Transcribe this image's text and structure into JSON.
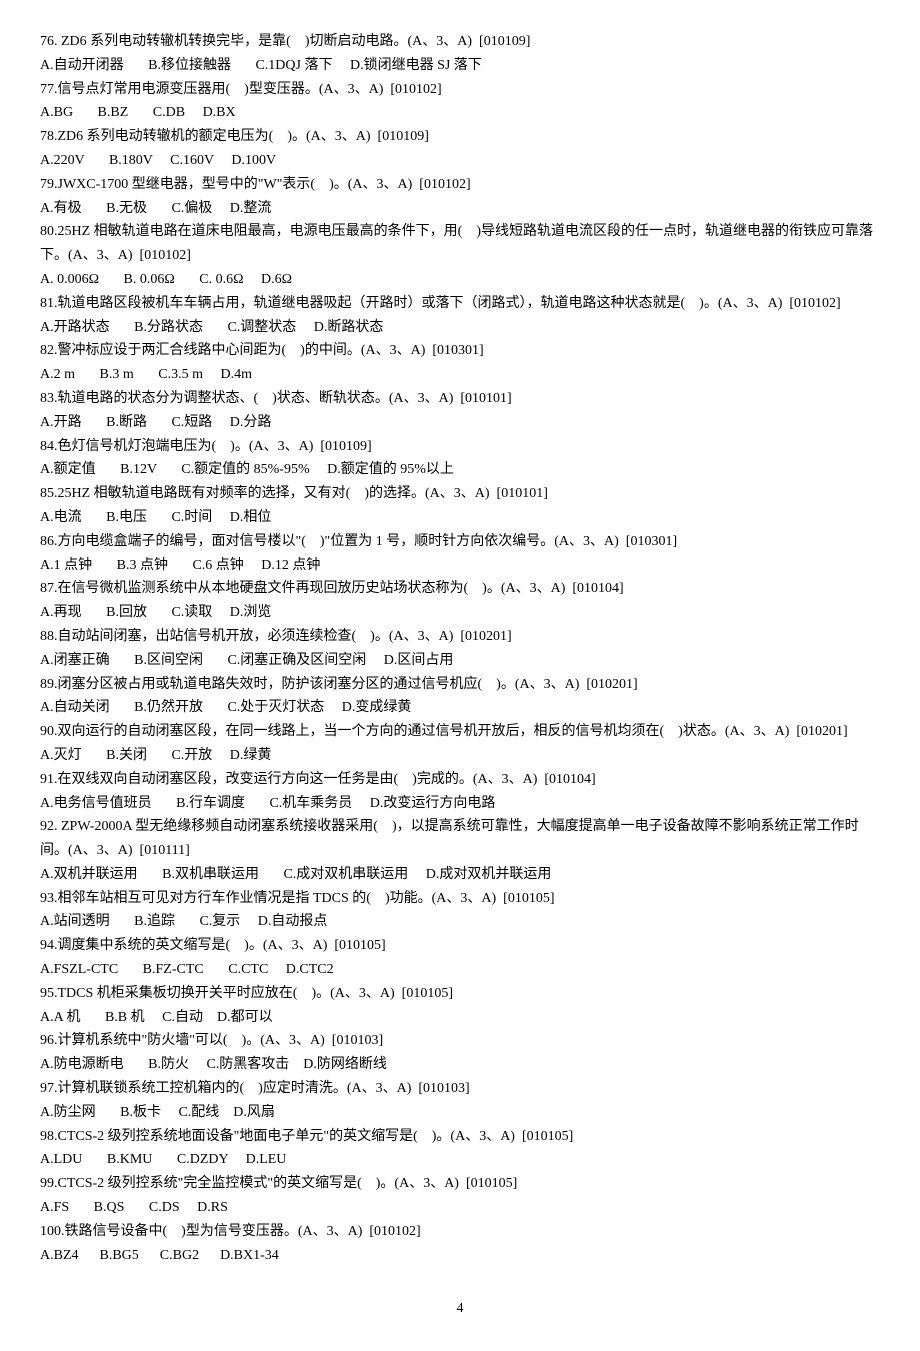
{
  "questions": [
    {
      "q": "76. ZD6 系列电动转辙机转换完毕，是靠(    )切断启动电路。(A、3、A)  [010109]",
      "opts": "A.自动开闭器       B.移位接触器       C.1DQJ 落下     D.锁闭继电器 SJ 落下"
    },
    {
      "q": "77.信号点灯常用电源变压器用(    )型变压器。(A、3、A)  [010102]",
      "opts": "A.BG       B.BZ       C.DB     D.BX"
    },
    {
      "q": "78.ZD6 系列电动转辙机的额定电压为(    )。(A、3、A)  [010109]",
      "opts": "A.220V       B.180V     C.160V     D.100V"
    },
    {
      "q": "79.JWXC-1700 型继电器，型号中的\"W\"表示(    )。(A、3、A)  [010102]",
      "opts": "A.有极       B.无极       C.偏极     D.整流"
    },
    {
      "q": "80.25HZ 相敏轨道电路在道床电阻最高，电源电压最高的条件下，用(    )导线短路轨道电流区段的任一点时，轨道继电器的衔铁应可靠落下。(A、3、A)  [010102]",
      "opts": "A. 0.006Ω       B. 0.06Ω       C. 0.6Ω     D.6Ω"
    },
    {
      "q": "81.轨道电路区段被机车车辆占用，轨道继电器吸起（开路时）或落下（闭路式），轨道电路这种状态就是(    )。(A、3、A)  [010102]",
      "opts": "A.开路状态       B.分路状态       C.调整状态     D.断路状态"
    },
    {
      "q": "82.警冲标应设于两汇合线路中心间距为(    )的中间。(A、3、A)  [010301]",
      "opts": "A.2 m       B.3 m       C.3.5 m     D.4m"
    },
    {
      "q": "83.轨道电路的状态分为调整状态、(    )状态、断轨状态。(A、3、A)  [010101]",
      "opts": "A.开路       B.断路       C.短路     D.分路"
    },
    {
      "q": "84.色灯信号机灯泡端电压为(    )。(A、3、A)  [010109]",
      "opts": "A.额定值       B.12V       C.额定值的 85%-95%     D.额定值的 95%以上"
    },
    {
      "q": "85.25HZ 相敏轨道电路既有对频率的选择，又有对(    )的选择。(A、3、A)  [010101]",
      "opts": "A.电流       B.电压       C.时间     D.相位"
    },
    {
      "q": "86.方向电缆盒端子的编号，面对信号楼以\"(    )\"位置为 1 号，顺时针方向依次编号。(A、3、A)  [010301]",
      "opts": "A.1 点钟       B.3 点钟       C.6 点钟     D.12 点钟"
    },
    {
      "q": "87.在信号微机监测系统中从本地硬盘文件再现回放历史站场状态称为(    )。(A、3、A)  [010104]",
      "opts": "A.再现       B.回放       C.读取     D.浏览"
    },
    {
      "q": "88.自动站间闭塞，出站信号机开放，必须连续检查(    )。(A、3、A)  [010201]",
      "opts": "A.闭塞正确       B.区间空闲       C.闭塞正确及区间空闲     D.区间占用"
    },
    {
      "q": "89.闭塞分区被占用或轨道电路失效时，防护该闭塞分区的通过信号机应(    )。(A、3、A)  [010201]",
      "opts": "A.自动关闭       B.仍然开放       C.处于灭灯状态     D.变成绿黄"
    },
    {
      "q": "90.双向运行的自动闭塞区段，在同一线路上，当一个方向的通过信号机开放后，相反的信号机均须在(    )状态。(A、3、A)  [010201]",
      "opts": "A.灭灯       B.关闭       C.开放     D.绿黄"
    },
    {
      "q": "91.在双线双向自动闭塞区段，改变运行方向这一任务是由(    )完成的。(A、3、A)  [010104]",
      "opts": "A.电务信号值班员       B.行车调度       C.机车乘务员     D.改变运行方向电路"
    },
    {
      "q": "92. ZPW-2000A 型无绝缘移频自动闭塞系统接收器采用(    )，以提高系统可靠性，大幅度提高单一电子设备故障不影响系统正常工作时间。(A、3、A)  [010111]",
      "opts": "A.双机并联运用       B.双机串联运用       C.成对双机串联运用     D.成对双机并联运用"
    },
    {
      "q": "93.相邻车站相互可见对方行车作业情况是指 TDCS 的(    )功能。(A、3、A)  [010105]",
      "opts": "A.站间透明       B.追踪       C.复示     D.自动报点"
    },
    {
      "q": "94.调度集中系统的英文缩写是(    )。(A、3、A)  [010105]",
      "opts": "A.FSZL-CTC       B.FZ-CTC       C.CTC     D.CTC2"
    },
    {
      "q": "95.TDCS 机柜采集板切换开关平时应放在(    )。(A、3、A)  [010105]",
      "opts": "A.A 机       B.B 机     C.自动    D.都可以"
    },
    {
      "q": "96.计算机系统中\"防火墙\"可以(    )。(A、3、A)  [010103]",
      "opts": "A.防电源断电       B.防火     C.防黑客攻击    D.防网络断线"
    },
    {
      "q": "97.计算机联锁系统工控机箱内的(    )应定时清洗。(A、3、A)  [010103]",
      "opts": "A.防尘网       B.板卡     C.配线    D.风扇"
    },
    {
      "q": "98.CTCS-2 级列控系统地面设备\"地面电子单元\"的英文缩写是(    )。(A、3、A)  [010105]",
      "opts": "A.LDU       B.KMU       C.DZDY     D.LEU"
    },
    {
      "q": "99.CTCS-2 级列控系统\"完全监控模式\"的英文缩写是(    )。(A、3、A)  [010105]",
      "opts": "A.FS       B.QS       C.DS     D.RS"
    },
    {
      "q": "100.铁路信号设备中(    )型为信号变压器。(A、3、A)  [010102]",
      "opts": "A.BZ4      B.BG5      C.BG2      D.BX1-34"
    }
  ],
  "pageNumber": "4"
}
